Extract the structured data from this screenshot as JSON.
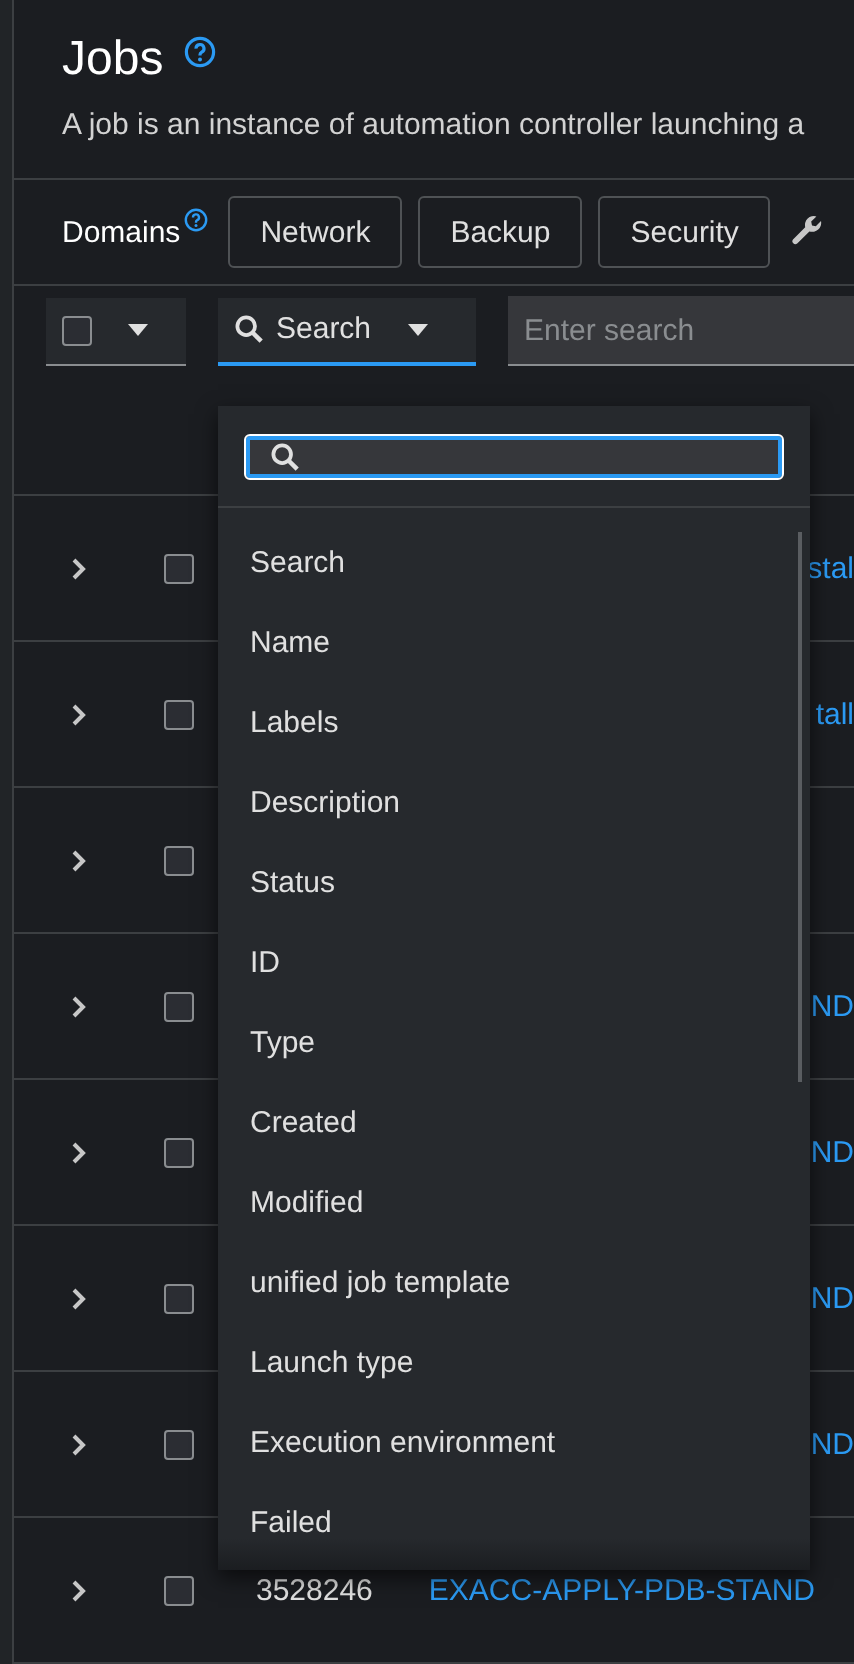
{
  "header": {
    "title": "Jobs",
    "description": "A job is an instance of automation controller launching a"
  },
  "domains": {
    "label": "Domains",
    "buttons": [
      "Network",
      "Backup",
      "Security"
    ]
  },
  "toolbar": {
    "select_all": {
      "checked": false
    },
    "filter": "Search",
    "search": {
      "placeholder": "Enter search"
    }
  },
  "rows": [
    {
      "checked": false,
      "link": "stal"
    },
    {
      "checked": false,
      "link": "tall"
    },
    {
      "checked": false
    },
    {
      "checked": false,
      "link": "ND"
    },
    {
      "checked": false,
      "link": "ND"
    },
    {
      "checked": false,
      "link": "ND"
    },
    {
      "checked": false,
      "link": "ND"
    },
    {
      "checked": false,
      "id": "3528246",
      "link": "EXACC-APPLY-PDB-STAND"
    }
  ],
  "filter_menu": {
    "items": [
      "Search",
      "Name",
      "Labels",
      "Description",
      "Status",
      "ID",
      "Type",
      "Created",
      "Modified",
      "unified job template",
      "Launch type",
      "Execution environment",
      "Failed"
    ]
  }
}
